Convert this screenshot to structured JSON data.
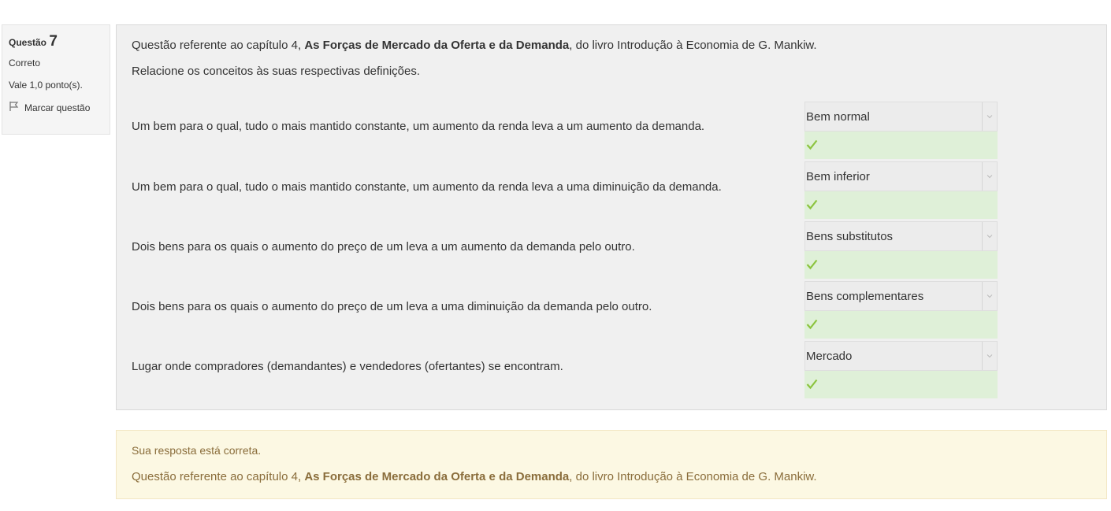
{
  "info": {
    "question_word": "Questão",
    "question_number": "7",
    "state": "Correto",
    "grade": "Vale 1,0 ponto(s).",
    "flag_label": "Marcar questão"
  },
  "question": {
    "intro_prefix": "Questão referente ao capítulo 4, ",
    "intro_bold": "As Forças de Mercado da Oferta e da Demanda",
    "intro_suffix": ", do livro Introdução à Economia de G. Mankiw.",
    "instruction": "Relacione os conceitos às suas respectivas definições.",
    "items": [
      {
        "text": "Um bem para o qual, tudo o mais mantido constante, um aumento da renda leva a um aumento da demanda.",
        "answer": "Bem normal"
      },
      {
        "text": "Um bem para o qual, tudo o mais mantido constante, um aumento da renda leva a uma diminuição da demanda.",
        "answer": "Bem inferior"
      },
      {
        "text": "Dois bens para os quais o aumento  do preço de um leva a um aumento da demanda pelo outro.",
        "answer": "Bens substitutos"
      },
      {
        "text": "Dois bens para os quais o aumento do preço de um leva a uma diminuição da demanda pelo outro.",
        "answer": "Bens complementares"
      },
      {
        "text": "Lugar onde compradores (demandantes) e vendedores (ofertantes) se encontram.",
        "answer": "Mercado"
      }
    ]
  },
  "feedback": {
    "result": "Sua resposta está correta.",
    "general_prefix": "Questão referente ao capítulo 4, ",
    "general_bold": "As Forças de Mercado da Oferta e da Demanda",
    "general_suffix": ", do livro Introdução à Economia de G. Mankiw."
  },
  "colors": {
    "correct_bg": "#dff0d8",
    "check": "#8cc43f",
    "feedback_bg": "#fcf8e3",
    "feedback_text": "#8a6d3b"
  },
  "icons": {
    "flag": "flag-icon",
    "select_arrow": "chevron-down-icon",
    "check": "check-icon"
  }
}
